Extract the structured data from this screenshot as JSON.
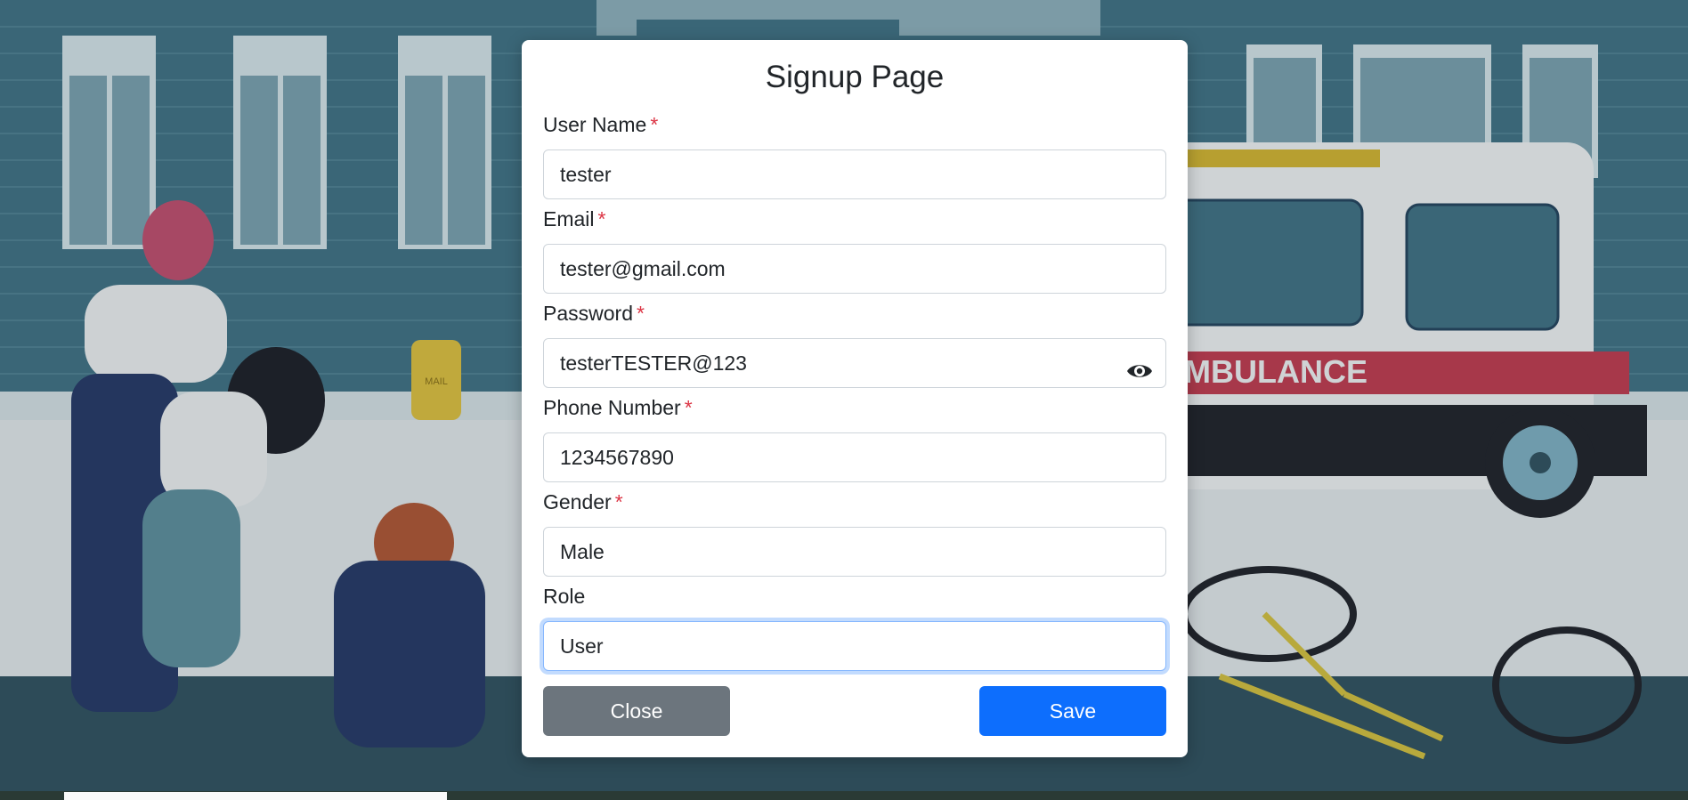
{
  "form": {
    "title": "Signup Page",
    "fields": [
      {
        "label": "User Name",
        "required": "*",
        "value": "tester"
      },
      {
        "label": "Email",
        "required": "*",
        "value": "tester@gmail.com"
      },
      {
        "label": "Password",
        "required": "*",
        "value": "testerTESTER@123",
        "icon": "eye-icon"
      },
      {
        "label": "Phone Number",
        "required": "*",
        "value": "1234567890"
      },
      {
        "label": "Gender",
        "required": "*",
        "value": "Male"
      },
      {
        "label": "Role",
        "value": "User"
      }
    ],
    "close_label": "Close",
    "save_label": "Save"
  },
  "background": {
    "ambulance_text": "MBULANCE",
    "mailbox_text": "MAIL"
  },
  "colors": {
    "primary": "#0d6efd",
    "secondary": "#6c757d",
    "required": "#dc3545"
  }
}
